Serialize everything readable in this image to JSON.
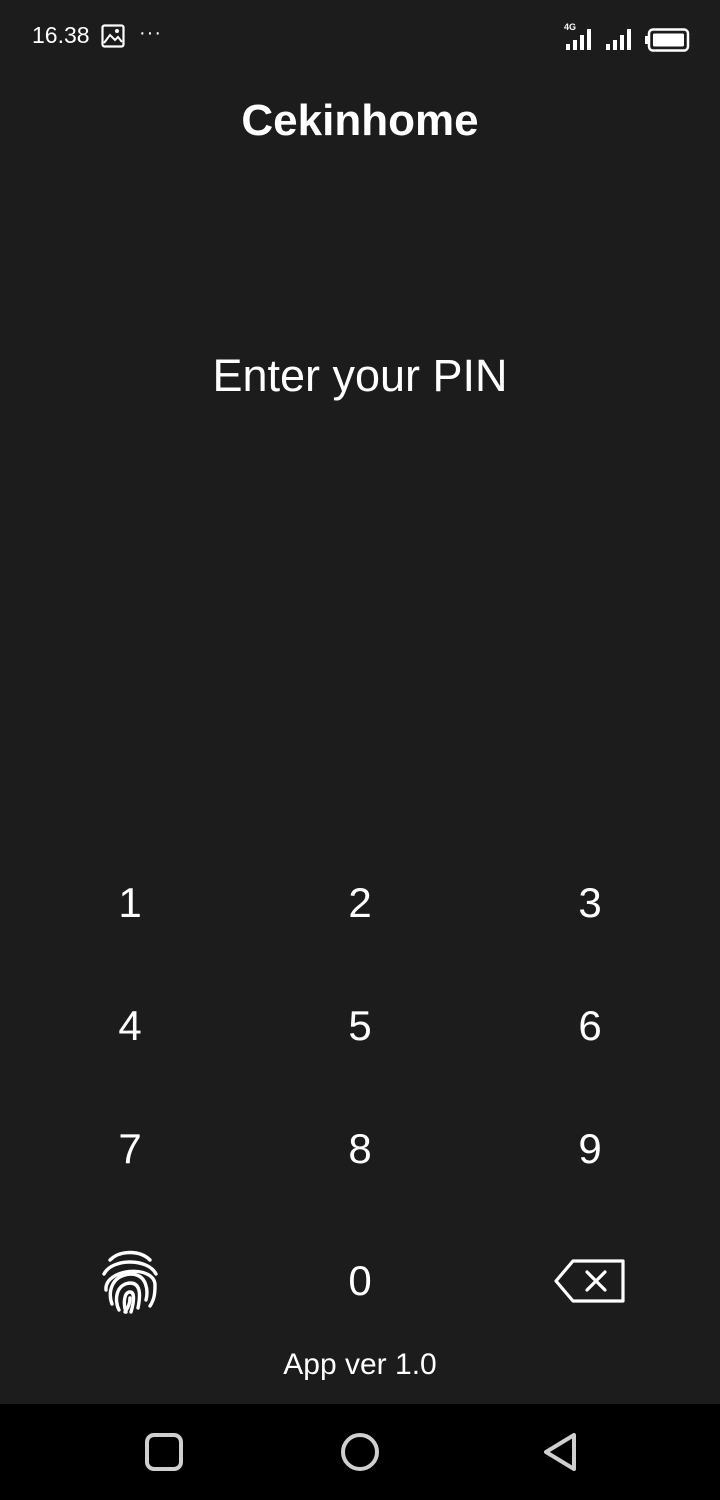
{
  "status_bar": {
    "time": "16.38",
    "network_label": "4G",
    "icons": [
      "gallery-icon",
      "more-dots-icon",
      "signal-4g-icon",
      "signal-icon",
      "battery-icon"
    ]
  },
  "app": {
    "title": "Cekinhome",
    "prompt": "Enter your PIN",
    "version": "App ver 1.0"
  },
  "keypad": {
    "keys": [
      "1",
      "2",
      "3",
      "4",
      "5",
      "6",
      "7",
      "8",
      "9",
      "0"
    ],
    "fingerprint_icon": "fingerprint-icon",
    "backspace_icon": "backspace-icon"
  },
  "nav_bar": {
    "buttons": [
      "recents-square-icon",
      "home-circle-icon",
      "back-triangle-icon"
    ]
  },
  "colors": {
    "background": "#1c1c1c",
    "text": "#ffffff",
    "nav_background": "#000000",
    "nav_icons": "#cfcfcf"
  }
}
